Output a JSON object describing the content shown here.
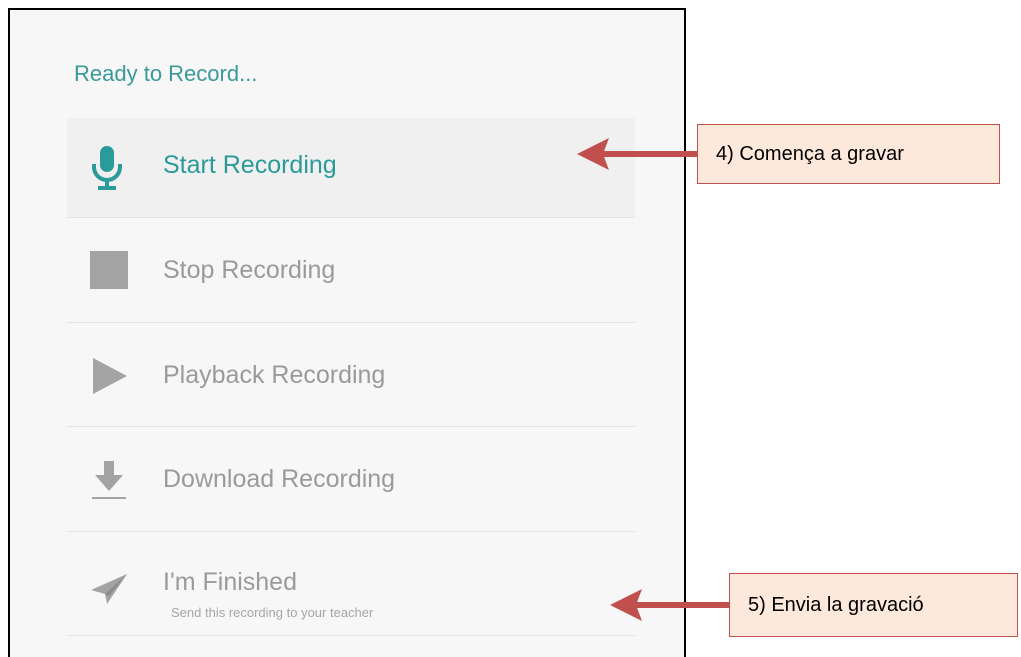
{
  "panel": {
    "status": "Ready to Record...",
    "items": [
      {
        "label": "Start Recording",
        "icon": "microphone-icon",
        "state": "active"
      },
      {
        "label": "Stop Recording",
        "icon": "stop-icon",
        "state": "disabled"
      },
      {
        "label": "Playback Recording",
        "icon": "play-icon",
        "state": "disabled"
      },
      {
        "label": "Download Recording",
        "icon": "download-icon",
        "state": "disabled"
      },
      {
        "label": "I'm Finished",
        "sublabel": "Send this recording to your teacher",
        "icon": "paper-plane-icon",
        "state": "disabled"
      }
    ]
  },
  "annotations": [
    {
      "text": "4) Comença a gravar",
      "points_to": "Start Recording"
    },
    {
      "text": "5) Envia la gravació",
      "points_to": "I'm Finished"
    }
  ],
  "colors": {
    "accent": "#2b9a9a",
    "disabled": "#9a9a9a",
    "arrow": "#c0504d",
    "callout_fill": "#fde9dc"
  }
}
